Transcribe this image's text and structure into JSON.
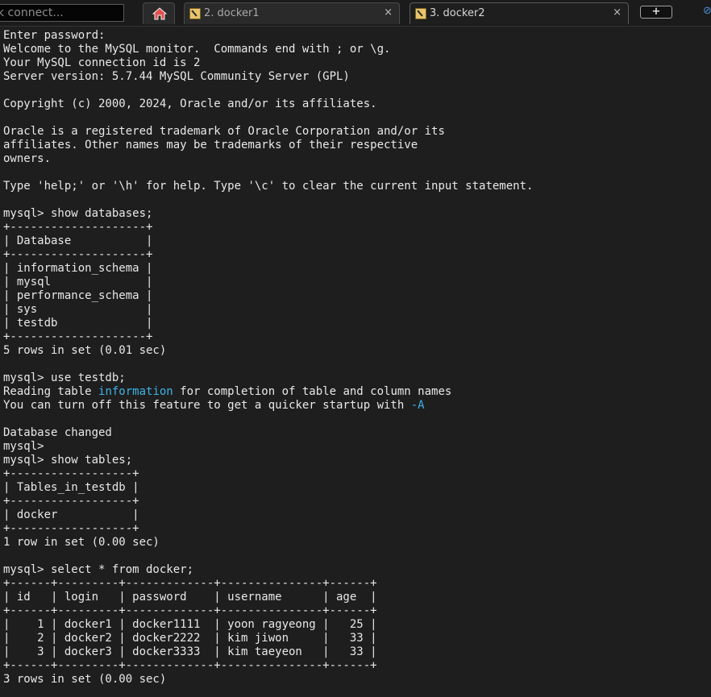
{
  "tabbar": {
    "quick_connect_placeholder": "k connect...",
    "home_icon": "home-icon",
    "tabs": [
      {
        "label": "2. docker1",
        "close": "×"
      },
      {
        "label": "3. docker2",
        "close": "×"
      }
    ],
    "new_tab_label": "+"
  },
  "terminal": {
    "lines": [
      "Enter password:",
      "Welcome to the MySQL monitor.  Commands end with ; or \\g.",
      "Your MySQL connection id is 2",
      "Server version: 5.7.44 MySQL Community Server (GPL)",
      "",
      "Copyright (c) 2000, 2024, Oracle and/or its affiliates.",
      "",
      "Oracle is a registered trademark of Oracle Corporation and/or its",
      "affiliates. Other names may be trademarks of their respective",
      "owners.",
      "",
      "Type 'help;' or '\\h' for help. Type '\\c' to clear the current input statement.",
      "",
      "mysql> show databases;",
      "+--------------------+",
      "| Database           |",
      "+--------------------+",
      "| information_schema |",
      "| mysql              |",
      "| performance_schema |",
      "| sys                |",
      "| testdb             |",
      "+--------------------+",
      "5 rows in set (0.01 sec)",
      "",
      "mysql> use testdb;",
      "Reading table information for completion of table and column names",
      "You can turn off this feature to get a quicker startup with -A",
      "",
      "Database changed",
      "mysql>",
      "mysql> show tables;",
      "+------------------+",
      "| Tables_in_testdb |",
      "+------------------+",
      "| docker           |",
      "+------------------+",
      "1 row in set (0.00 sec)",
      "",
      "mysql> select * from docker;",
      "+------+---------+-------------+---------------+------+",
      "| id   | login   | password    | username      | age  |",
      "+------+---------+-------------+---------------+------+",
      "|    1 | docker1 | docker1111  | yoon ragyeong |   25 |",
      "|    2 | docker2 | docker2222  | kim jiwon     |   33 |",
      "|    3 | docker3 | docker3333  | kim taeyeon   |   33 |",
      "+------+---------+-------------+---------------+------+",
      "3 rows in set (0.00 sec)"
    ],
    "highlights": {
      "26": [
        "information"
      ],
      "27": [
        "-A"
      ]
    },
    "highlight_color": "#3db3e6"
  }
}
